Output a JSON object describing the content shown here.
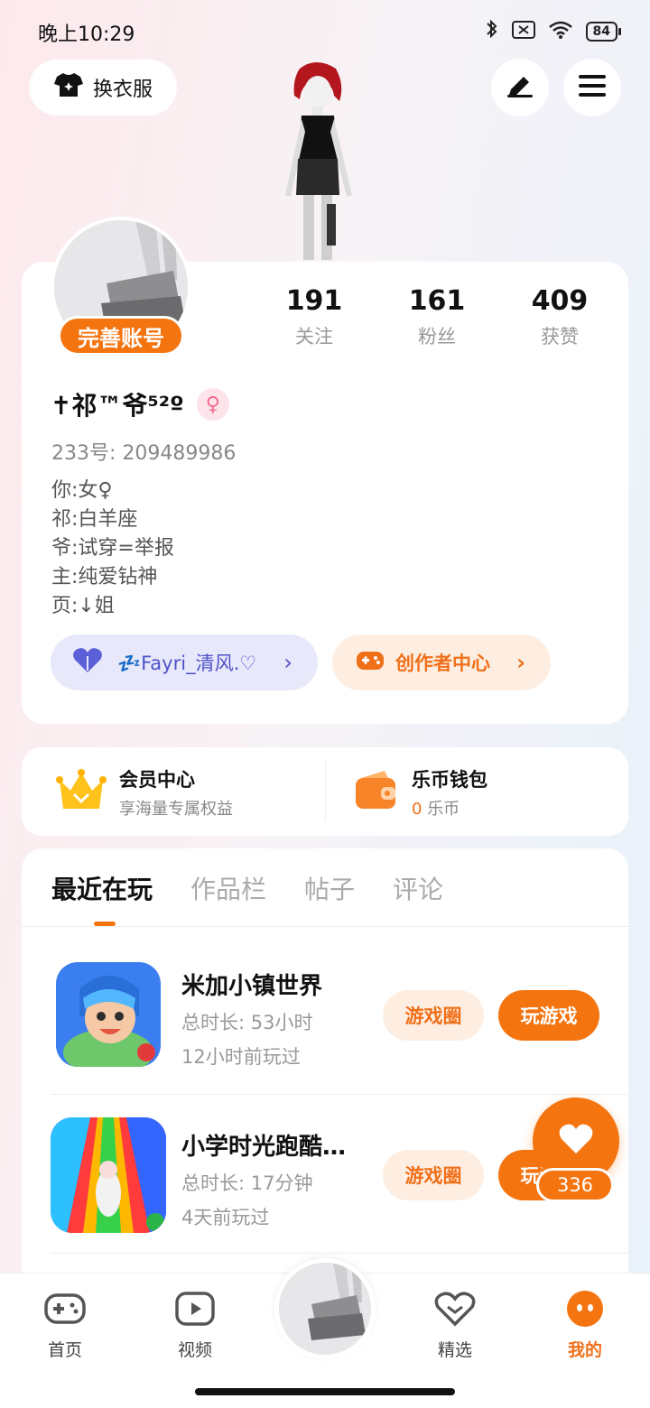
{
  "status_bar": {
    "time": "晚上10:29",
    "battery": "84"
  },
  "header": {
    "outfit_label": "换衣服"
  },
  "profile": {
    "complete_badge": "完善账号",
    "stats": [
      {
        "value": "191",
        "label": "关注"
      },
      {
        "value": "161",
        "label": "粉丝"
      },
      {
        "value": "409",
        "label": "获赞"
      }
    ],
    "nickname": "✝祁™爷⁵²º",
    "gender_symbol": "♀",
    "uid": "233号: 209489986",
    "bio": [
      "你:女♀",
      "祁:白羊座",
      "爷:试穿=举报",
      "主:纯爱钻神",
      "页:↓姐"
    ],
    "fan_club": "💤Fayri_清风.♡",
    "creator_center": "创作者中心"
  },
  "vip": {
    "member_title": "会员中心",
    "member_sub": "享海量专属权益",
    "wallet_title": "乐币钱包",
    "wallet_amount": "0",
    "wallet_unit": "乐币"
  },
  "tabs": [
    "最近在玩",
    "作品栏",
    "帖子",
    "评论"
  ],
  "games": [
    {
      "name": "米加小镇世界",
      "duration": "总时长: 53小时",
      "last_played": "12小时前玩过",
      "circle_label": "游戏圈",
      "play_label": "玩游戏"
    },
    {
      "name": "小学时光跑酷…",
      "duration": "总时长: 17分钟",
      "last_played": "4天前玩过",
      "circle_label": "游戏圈",
      "play_label": "玩游戏"
    }
  ],
  "like": {
    "count": "336"
  },
  "nav": [
    {
      "label": "首页"
    },
    {
      "label": "视频"
    },
    {
      "label": "精选"
    },
    {
      "label": "我的"
    }
  ],
  "colors": {
    "accent": "#f47410",
    "fan_pill": "#e8e8fb",
    "creator_pill": "#feeee2"
  }
}
